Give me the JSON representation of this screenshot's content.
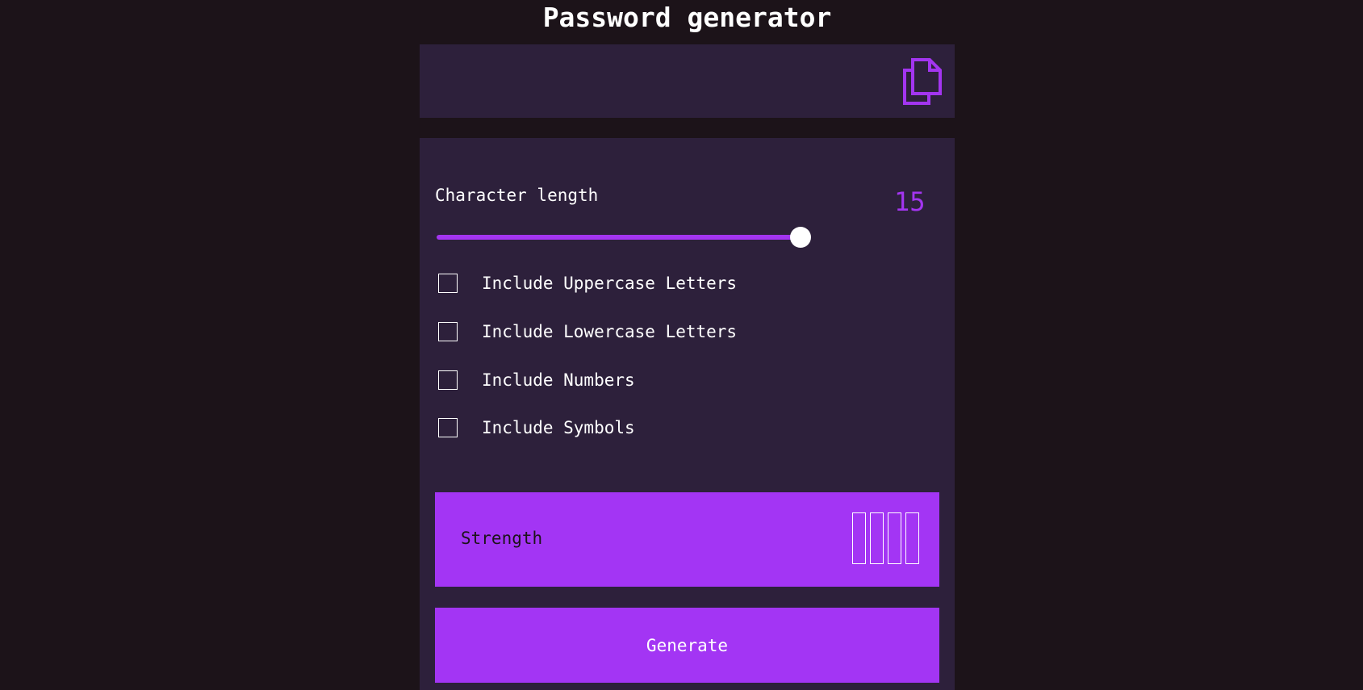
{
  "header": {
    "title": "Password generator"
  },
  "output": {
    "password": "",
    "copy_icon": "copy-icon"
  },
  "settings": {
    "length_label": "Character length",
    "length_value": "15",
    "slider_level": 0.94,
    "options": [
      {
        "label": "Include Uppercase Letters",
        "checked": false
      },
      {
        "label": "Include Lowercase Letters",
        "checked": false
      },
      {
        "label": "Include Numbers",
        "checked": false
      },
      {
        "label": "Include Symbols",
        "checked": false
      }
    ]
  },
  "strength": {
    "label": "Strength",
    "bars_filled": 0,
    "bars_total": 4
  },
  "actions": {
    "generate_label": "Generate"
  },
  "colors": {
    "background": "#1c1319",
    "panel": "#2d203b",
    "accent": "#a335f4",
    "text": "#ffffff"
  }
}
